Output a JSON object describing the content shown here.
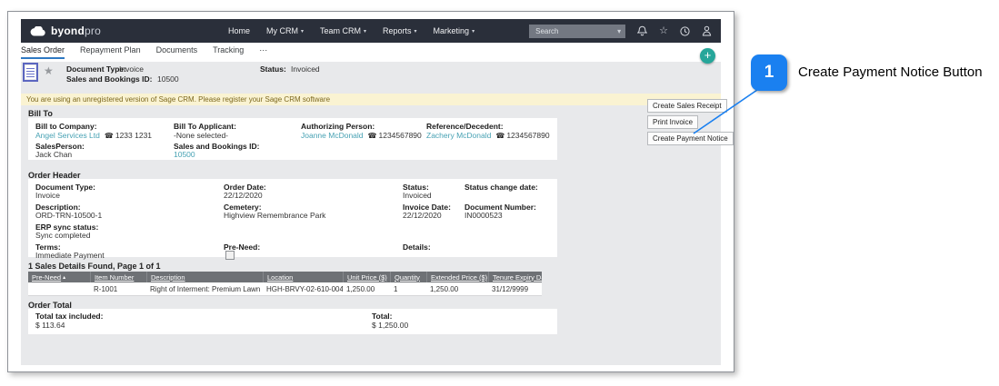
{
  "navbar": {
    "brand": {
      "bold": "byond",
      "light": "pro"
    },
    "menu": [
      {
        "label": "Home"
      },
      {
        "label": "My CRM",
        "caret": "▾"
      },
      {
        "label": "Team CRM",
        "caret": "▾"
      },
      {
        "label": "Reports",
        "caret": "▾"
      },
      {
        "label": "Marketing",
        "caret": "▾"
      }
    ],
    "search_placeholder": "Search",
    "search_caret": "▾",
    "star_glyph": "☆"
  },
  "tabs": {
    "items": [
      {
        "label": "Sales Order"
      },
      {
        "label": "Repayment Plan"
      },
      {
        "label": "Documents"
      },
      {
        "label": "Tracking"
      }
    ],
    "more_label": "⋯"
  },
  "summary": {
    "fav_star_glyph": "★",
    "document_type_label": "Document Type:",
    "document_type": "Invoice",
    "sales_bookings_id_label": "Sales and Bookings ID:",
    "sales_bookings_id": "10500",
    "status_label": "Status:",
    "status": "Invoiced"
  },
  "banner_text": "You are using an unregistered version of Sage CRM. Please register your Sage CRM software",
  "bill_to": {
    "title": "Bill To",
    "company_label": "Bill to Company:",
    "company": "Angel Services Ltd",
    "company_phone": "1233 1231",
    "applicant_label": "Bill To Applicant:",
    "applicant": "-None selected-",
    "authorizing_label": "Authorizing Person:",
    "authorizing": "Joanne McDonald",
    "authorizing_phone": "1234567890",
    "reference_label": "Reference/Decedent:",
    "reference": "Zachery McDonald",
    "reference_phone": "1234567890",
    "salesperson_label": "SalesPerson:",
    "salesperson": "Jack Chan",
    "sbid_label": "Sales and Bookings ID:",
    "sbid": "10500",
    "phone_glyph": "☎"
  },
  "order_header": {
    "title": "Order Header",
    "document_type_label": "Document Type:",
    "document_type": "Invoice",
    "order_date_label": "Order Date:",
    "order_date": "22/12/2020",
    "status_label": "Status:",
    "status": "Invoiced",
    "status_change_label": "Status change date:",
    "status_change": "",
    "description_label": "Description:",
    "description": "ORD-TRN-10500-1",
    "cemetery_label": "Cemetery:",
    "cemetery": "Highview Remembrance Park",
    "invoice_date_label": "Invoice Date:",
    "invoice_date": "22/12/2020",
    "document_number_label": "Document Number:",
    "document_number": "IN0000523",
    "erp_label": "ERP sync status:",
    "erp": "Sync completed",
    "terms_label": "Terms:",
    "terms": "Immediate Payment",
    "pre_need_label": "Pre-Need:",
    "details_label": "Details:",
    "details": ""
  },
  "sales_details": {
    "found_text": "1 Sales Details Found, Page 1 of 1",
    "headers": [
      {
        "label": "Pre-Need",
        "sort": "▴"
      },
      {
        "label": "Item Number"
      },
      {
        "label": "Description"
      },
      {
        "label": "Location"
      },
      {
        "label": "Unit Price ($)"
      },
      {
        "label": "Quantity"
      },
      {
        "label": "Extended Price ($)"
      },
      {
        "label": "Tenure Expiry Date"
      }
    ],
    "row": {
      "pre_need": "",
      "item_number": "R-1001",
      "description": "Right of Interment: Premium Lawn Grave",
      "location": "HGH-BRVY-02-610-004",
      "unit_price": "1,250.00",
      "quantity": "1",
      "extended_price": "1,250.00",
      "tenure_expiry": "31/12/9999"
    }
  },
  "order_total": {
    "title": "Order Total",
    "tax_label": "Total tax included:",
    "tax": "$ 113.64",
    "total_label": "Total:",
    "total": "$ 1,250.00"
  },
  "side_buttons": [
    {
      "label": "Create Sales Receipt"
    },
    {
      "label": "Print Invoice"
    },
    {
      "label": "Create Payment Notice"
    }
  ],
  "add_button_label": "+",
  "annotation": {
    "number": "1",
    "label": "Create Payment Notice Button"
  },
  "colors": {
    "navbar_bg": "#2a2f3a",
    "tab_active_underline": "#2e78c2",
    "link_teal": "#46a1b3",
    "add_green": "#26a69a",
    "banner_bg": "#faf3d2",
    "table_header_bg": "#6e7175",
    "annotation_blue": "#1a80f0"
  }
}
